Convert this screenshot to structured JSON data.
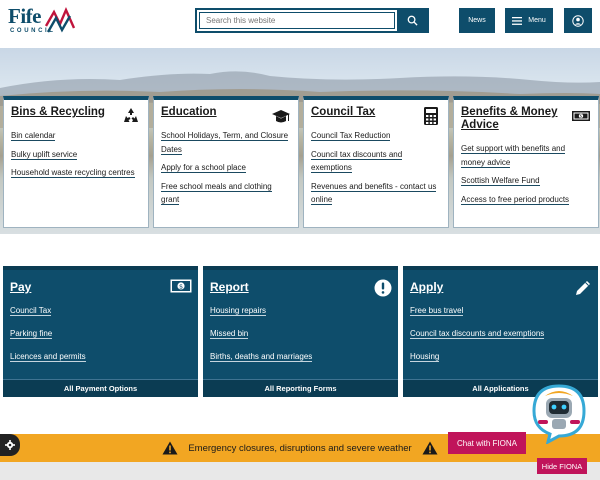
{
  "brand": {
    "name": "Fife",
    "sub": "COUNCIL"
  },
  "header": {
    "search_placeholder": "Search this website",
    "news_label": "News",
    "menu_label": "Menu"
  },
  "cards": [
    {
      "title": "Bins & Recycling",
      "icon": "recycle-icon",
      "links": [
        "Bin calendar",
        "Bulky uplift service",
        "Household waste recycling centres"
      ]
    },
    {
      "title": "Education",
      "icon": "graduation-cap-icon",
      "links": [
        "School Holidays, Term, and Closure Dates",
        "Apply for a school place",
        "Free school meals and clothing grant"
      ]
    },
    {
      "title": "Council Tax",
      "icon": "calculator-icon",
      "links": [
        "Council Tax Reduction",
        "Council tax discounts and exemptions",
        "Revenues and benefits - contact us online"
      ]
    },
    {
      "title": "Benefits & Money Advice",
      "icon": "money-icon",
      "links": [
        "Get support with benefits and money advice",
        "Scottish Welfare Fund",
        "Access to free period products"
      ]
    }
  ],
  "panels": [
    {
      "title": "Pay",
      "icon": "money-icon",
      "links": [
        "Council Tax",
        "Parking fine",
        "Licences and permits"
      ],
      "footer": "All Payment Options"
    },
    {
      "title": "Report",
      "icon": "exclamation-icon",
      "links": [
        "Housing repairs",
        "Missed bin",
        "Births, deaths and marriages"
      ],
      "footer": "All Reporting Forms"
    },
    {
      "title": "Apply",
      "icon": "pencil-icon",
      "links": [
        "Free bus travel",
        "Council tax discounts and exemptions",
        "Housing"
      ],
      "footer": "All Applications"
    }
  ],
  "alert": {
    "text": "Emergency closures, disruptions and severe weather"
  },
  "chat": {
    "open_label": "Chat with FIONA",
    "hide_label": "Hide FIONA"
  },
  "colors": {
    "primary": "#0e4d6b",
    "alert": "#f2a622",
    "chat": "#c0145a"
  }
}
